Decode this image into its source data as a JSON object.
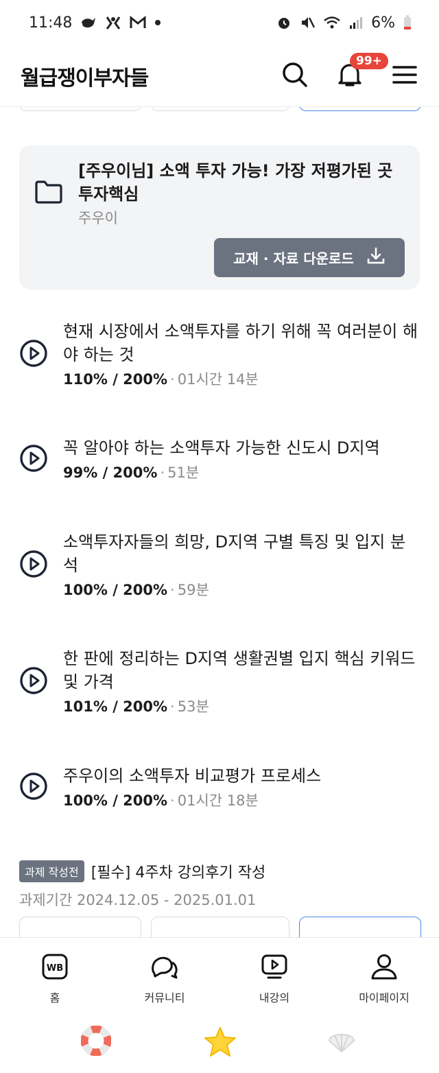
{
  "status_bar": {
    "time": "11:48",
    "battery": "6%"
  },
  "header": {
    "brand": "월급쟁이부자들",
    "notification_badge": "99+"
  },
  "material": {
    "title": "[주우이님] 소액 투자 가능! 가장 저평가된 곳 투자핵심",
    "author": "주우이",
    "download_label": "교재 · 자료 다운로드"
  },
  "lectures": [
    {
      "title": "현재 시장에서 소액투자를 하기 위해 꼭 여러분이 해야 하는 것",
      "progress": "110% / 200%",
      "duration": "01시간 14분"
    },
    {
      "title": "꼭 알아야 하는 소액투자 가능한 신도시 D지역",
      "progress": "99% / 200%",
      "duration": "51분"
    },
    {
      "title": "소액투자자들의 희망, D지역 구별 특징 및 입지 분석",
      "progress": "100% / 200%",
      "duration": "59분"
    },
    {
      "title": "한 판에 정리하는 D지역 생활권별 입지 핵심 키워드 및 가격",
      "progress": "101% / 200%",
      "duration": "53분"
    },
    {
      "title": "주우이의 소액투자 비교평가 프로세스",
      "progress": "100% / 200%",
      "duration": "01시간 18분"
    }
  ],
  "assignment": {
    "badge": "과제 작성전",
    "title": "[필수] 4주차 강의후기 작성",
    "period": "과제기간 2024.12.05 - 2025.01.01"
  },
  "bottom_nav": {
    "items": [
      {
        "label": "홈",
        "icon": "wb-home-icon"
      },
      {
        "label": "커뮤니티",
        "icon": "chat-bubbles-icon"
      },
      {
        "label": "내강의",
        "icon": "play-screen-icon"
      },
      {
        "label": "마이페이지",
        "icon": "person-icon"
      }
    ]
  },
  "colors": {
    "badge_red": "#e8443a",
    "button_gray": "#6b7280",
    "accent_blue": "#4a86e8"
  }
}
